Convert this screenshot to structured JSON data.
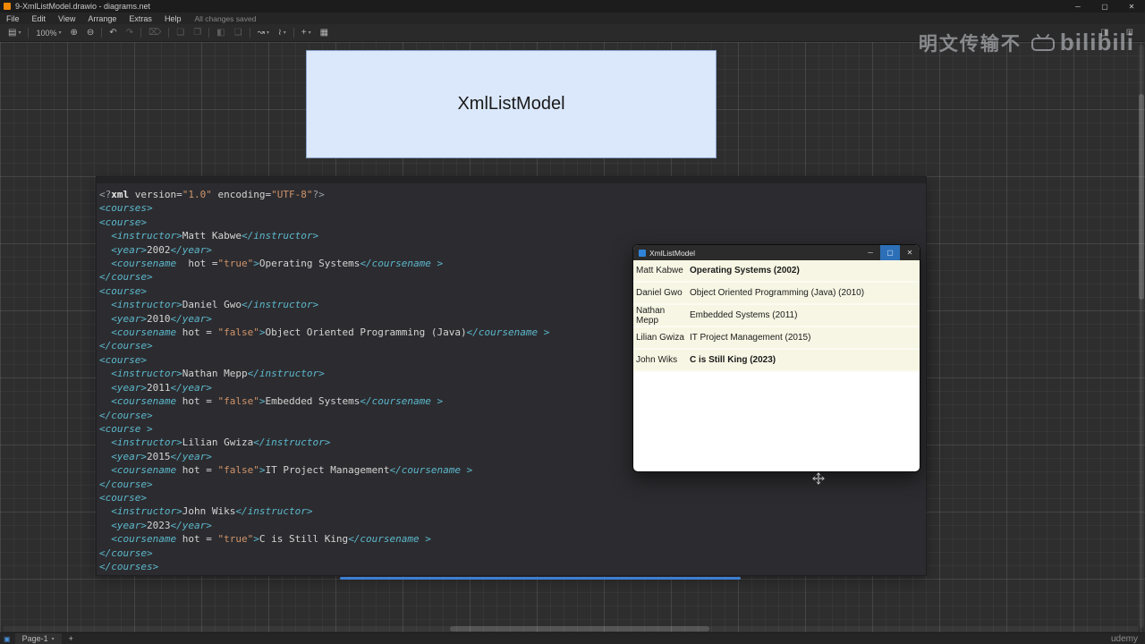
{
  "titlebar": {
    "title": "9-XmlListModel.drawio - diagrams.net",
    "controls": {
      "minimize": "─",
      "maximize": "▢",
      "close": "✕"
    }
  },
  "menubar": {
    "items": [
      "File",
      "Edit",
      "View",
      "Arrange",
      "Extras",
      "Help"
    ],
    "status": "All changes saved"
  },
  "toolbar": {
    "items": [
      {
        "name": "view-icon",
        "glyph": "▤",
        "chevron": true
      },
      {
        "divider": true
      },
      {
        "name": "zoom-select",
        "label": "100%",
        "chevron": true
      },
      {
        "name": "zoom-in-icon",
        "glyph": "⊕"
      },
      {
        "name": "zoom-out-icon",
        "glyph": "⊖"
      },
      {
        "divider": true
      },
      {
        "name": "undo-icon",
        "glyph": "↶"
      },
      {
        "name": "redo-icon",
        "glyph": "↷",
        "disabled": true
      },
      {
        "divider": true
      },
      {
        "name": "delete-icon",
        "glyph": "⌦",
        "disabled": true
      },
      {
        "divider": true
      },
      {
        "name": "to-front-icon",
        "glyph": "❏",
        "disabled": true
      },
      {
        "name": "to-back-icon",
        "glyph": "❐",
        "disabled": true
      },
      {
        "divider": true
      },
      {
        "name": "fill-color-icon",
        "glyph": "◧",
        "disabled": true
      },
      {
        "name": "shadow-icon",
        "glyph": "❑",
        "disabled": true
      },
      {
        "divider": true
      },
      {
        "name": "connection-icon",
        "glyph": "↝",
        "chevron": true
      },
      {
        "name": "waypoints-icon",
        "glyph": "≀",
        "chevron": true
      },
      {
        "divider": true
      },
      {
        "name": "insert-icon",
        "glyph": "+",
        "chevron": true
      },
      {
        "name": "table-icon",
        "glyph": "▦"
      }
    ],
    "right_items": [
      {
        "name": "format-panel-toggle-icon",
        "glyph": "◨"
      },
      {
        "name": "expand-icon",
        "glyph": "⊞"
      }
    ]
  },
  "canvas": {
    "title_box": {
      "label": "XmlListModel"
    },
    "code": {
      "lines": [
        [
          [
            "pq",
            "<?"
          ],
          [
            "kw",
            "xml"
          ],
          [
            "pl",
            " version="
          ],
          [
            "st",
            "\"1.0\""
          ],
          [
            "pl",
            " encoding="
          ],
          [
            "st",
            "\"UTF-8\""
          ],
          [
            "pq",
            "?>"
          ]
        ],
        [
          [
            "tg",
            "<courses>"
          ]
        ],
        [
          [
            "tg",
            "<course>"
          ]
        ],
        [
          [
            "pl",
            "  "
          ],
          [
            "tg",
            "<instructor>"
          ],
          [
            "pl",
            "Matt Kabwe"
          ],
          [
            "tg",
            "</instructor>"
          ]
        ],
        [
          [
            "pl",
            "  "
          ],
          [
            "tg",
            "<year>"
          ],
          [
            "pl",
            "2002"
          ],
          [
            "tg",
            "</year>"
          ]
        ],
        [
          [
            "pl",
            "  "
          ],
          [
            "tg",
            "<coursename"
          ],
          [
            "pl",
            "  hot ="
          ],
          [
            "st",
            "\"true\""
          ],
          [
            "tg",
            ">"
          ],
          [
            "pl",
            "Operating Systems"
          ],
          [
            "tg",
            "</coursename >"
          ]
        ],
        [
          [
            "tg",
            "</course>"
          ]
        ],
        [
          [
            "tg",
            "<course>"
          ]
        ],
        [
          [
            "pl",
            "  "
          ],
          [
            "tg",
            "<instructor>"
          ],
          [
            "pl",
            "Daniel Gwo"
          ],
          [
            "tg",
            "</instructor>"
          ]
        ],
        [
          [
            "pl",
            "  "
          ],
          [
            "tg",
            "<year>"
          ],
          [
            "pl",
            "2010"
          ],
          [
            "tg",
            "</year>"
          ]
        ],
        [
          [
            "pl",
            "  "
          ],
          [
            "tg",
            "<coursename"
          ],
          [
            "pl",
            " hot = "
          ],
          [
            "st",
            "\"false\""
          ],
          [
            "tg",
            ">"
          ],
          [
            "pl",
            "Object Oriented Programming (Java)"
          ],
          [
            "tg",
            "</coursename >"
          ]
        ],
        [
          [
            "tg",
            "</course>"
          ]
        ],
        [
          [
            "tg",
            "<course>"
          ]
        ],
        [
          [
            "pl",
            "  "
          ],
          [
            "tg",
            "<instructor>"
          ],
          [
            "pl",
            "Nathan Mepp"
          ],
          [
            "tg",
            "</instructor>"
          ]
        ],
        [
          [
            "pl",
            "  "
          ],
          [
            "tg",
            "<year>"
          ],
          [
            "pl",
            "2011"
          ],
          [
            "tg",
            "</year>"
          ]
        ],
        [
          [
            "pl",
            "  "
          ],
          [
            "tg",
            "<coursename"
          ],
          [
            "pl",
            " hot = "
          ],
          [
            "st",
            "\"false\""
          ],
          [
            "tg",
            ">"
          ],
          [
            "pl",
            "Embedded Systems"
          ],
          [
            "tg",
            "</coursename >"
          ]
        ],
        [
          [
            "tg",
            "</course>"
          ]
        ],
        [
          [
            "tg",
            "<course >"
          ]
        ],
        [
          [
            "pl",
            "  "
          ],
          [
            "tg",
            "<instructor>"
          ],
          [
            "pl",
            "Lilian Gwiza"
          ],
          [
            "tg",
            "</instructor>"
          ]
        ],
        [
          [
            "pl",
            "  "
          ],
          [
            "tg",
            "<year>"
          ],
          [
            "pl",
            "2015"
          ],
          [
            "tg",
            "</year>"
          ]
        ],
        [
          [
            "pl",
            "  "
          ],
          [
            "tg",
            "<coursename"
          ],
          [
            "pl",
            " hot = "
          ],
          [
            "st",
            "\"false\""
          ],
          [
            "tg",
            ">"
          ],
          [
            "pl",
            "IT Project Management"
          ],
          [
            "tg",
            "</coursename >"
          ]
        ],
        [
          [
            "tg",
            "</course>"
          ]
        ],
        [
          [
            "tg",
            "<course>"
          ]
        ],
        [
          [
            "pl",
            "  "
          ],
          [
            "tg",
            "<instructor>"
          ],
          [
            "pl",
            "John Wiks"
          ],
          [
            "tg",
            "</instructor>"
          ]
        ],
        [
          [
            "pl",
            "  "
          ],
          [
            "tg",
            "<year>"
          ],
          [
            "pl",
            "2023"
          ],
          [
            "tg",
            "</year>"
          ]
        ],
        [
          [
            "pl",
            "  "
          ],
          [
            "tg",
            "<coursename"
          ],
          [
            "pl",
            " hot = "
          ],
          [
            "st",
            "\"true\""
          ],
          [
            "tg",
            ">"
          ],
          [
            "pl",
            "C is Still King"
          ],
          [
            "tg",
            "</coursename >"
          ]
        ],
        [
          [
            "tg",
            "</course>"
          ]
        ],
        [
          [
            "tg",
            "</courses>"
          ]
        ]
      ]
    },
    "app_window": {
      "title": "XmlListModel",
      "controls": {
        "minimize": "─",
        "maximize": "▢",
        "close": "✕"
      },
      "rows": [
        {
          "instructor": "Matt Kabwe",
          "course": "Operating Systems (2002)",
          "bold": true
        },
        {
          "instructor": "Daniel Gwo",
          "course": "Object Oriented Programming (Java) (2010)",
          "bold": false
        },
        {
          "instructor": "Nathan Mepp",
          "course": "Embedded Systems (2011)",
          "bold": false
        },
        {
          "instructor": "Lilian Gwiza",
          "course": "IT Project Management (2015)",
          "bold": false
        },
        {
          "instructor": "John Wiks",
          "course": "C is Still King (2023)",
          "bold": true
        }
      ]
    }
  },
  "watermark": {
    "text": "明文传输不",
    "brand": "bilibili"
  },
  "footer": {
    "page_tab": "Page-1",
    "add_label": "+",
    "brand": "udemy"
  },
  "colors": {
    "accent_blue": "#3d7ed2",
    "shape_fill": "#dbe8fb",
    "list_row": "#f7f6e4",
    "tag": "#5cb8cc",
    "string": "#d1946a"
  }
}
